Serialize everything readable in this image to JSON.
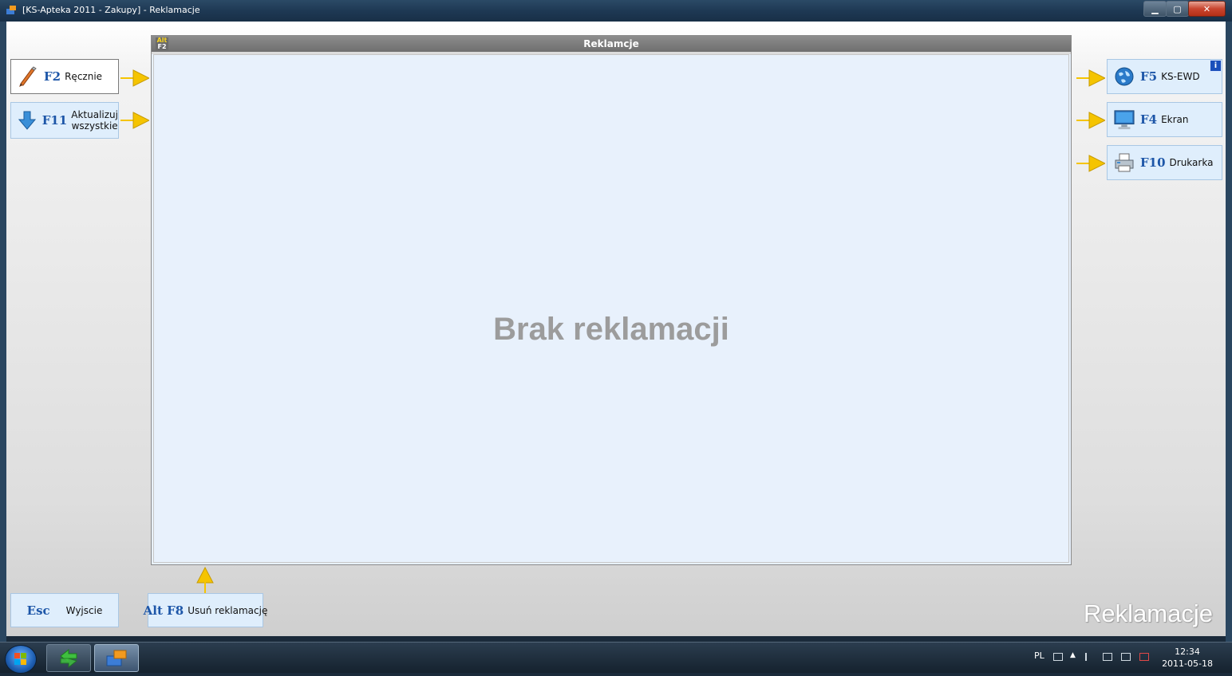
{
  "window": {
    "title": "[KS-Apteka 2011 - Zakupy] - Reklamacje",
    "min_label": "▁",
    "max_label": "▢",
    "close_label": "✕"
  },
  "left_buttons": [
    {
      "key": "F2",
      "label": "Ręcznie",
      "icon": "pencil-icon"
    },
    {
      "key": "F11",
      "label_line1": "Aktualizuj",
      "label_line2": "wszystkie",
      "icon": "down-arrow-icon"
    }
  ],
  "panel": {
    "title": "Reklamcje",
    "shortcut_alt": "Alt",
    "shortcut_key": "F2",
    "empty_message": "Brak reklamacji"
  },
  "right_buttons": [
    {
      "key": "F5",
      "label": "KS-EWD",
      "icon": "globe-icon",
      "badge": "i"
    },
    {
      "key": "F4",
      "label": "Ekran",
      "icon": "monitor-icon"
    },
    {
      "key": "F10",
      "label": "Drukarka",
      "icon": "printer-icon"
    }
  ],
  "bottom_buttons": [
    {
      "key": "Esc",
      "label": "Wyjscie"
    },
    {
      "key": "Alt F8",
      "label": "Usuń reklamację"
    }
  ],
  "watermark": "Reklamacje",
  "taskbar": {
    "language": "PL",
    "time": "12:34",
    "date": "2011-05-18"
  },
  "colors": {
    "accent": "#1d56a8",
    "button_bg": "#dfeefc",
    "panel_bg": "#e8f1fc",
    "arrow": "#f5c400"
  }
}
